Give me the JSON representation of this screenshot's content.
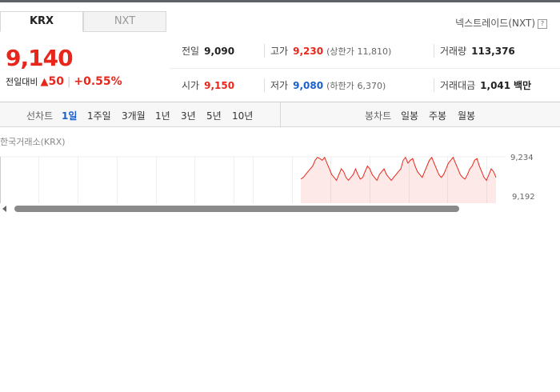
{
  "tabs": {
    "krx": "KRX",
    "nxt": "NXT"
  },
  "nxt_link": "넥스트레이드(NXT)",
  "help_glyph": "?",
  "price": "9,140",
  "change": {
    "label": "전일대비",
    "amount": "50",
    "percent": "+0.55%"
  },
  "stats": {
    "prev_close": {
      "label": "전일",
      "value": "9,090"
    },
    "high": {
      "label": "고가",
      "value": "9,230",
      "limit_label": "(상한가",
      "limit_value": "11,810)"
    },
    "volume": {
      "label": "거래량",
      "value": "113,376"
    },
    "open": {
      "label": "시가",
      "value": "9,150"
    },
    "low": {
      "label": "저가",
      "value": "9,080",
      "limit_label": "(하한가",
      "limit_value": "6,370)"
    },
    "amount": {
      "label": "거래대금",
      "value": "1,041",
      "unit": "백만"
    }
  },
  "line_chart_label": "선차트",
  "periods": [
    "1일",
    "1주일",
    "3개월",
    "1년",
    "3년",
    "5년",
    "10년"
  ],
  "active_period": "1일",
  "candle_chart_label": "봉차트",
  "candles": [
    "일봉",
    "주봉",
    "월봉"
  ],
  "chart_data": {
    "type": "line",
    "title": "한국거래소(KRX)",
    "y_ticks": [
      "9,234",
      "9,192"
    ],
    "ylim": [
      9150,
      9245
    ],
    "series": [
      {
        "values": [
          9192,
          9195,
          9200,
          9205,
          9210,
          9215,
          9225,
          9230,
          9228,
          9225,
          9230,
          9220,
          9210,
          9200,
          9195,
          9190,
          9200,
          9210,
          9205,
          9195,
          9190,
          9195,
          9200,
          9210,
          9200,
          9192,
          9195,
          9205,
          9215,
          9210,
          9200,
          9195,
          9190,
          9200,
          9205,
          9210,
          9200,
          9195,
          9190,
          9195,
          9200,
          9205,
          9210,
          9225,
          9230,
          9220,
          9225,
          9228,
          9215,
          9205,
          9200,
          9195,
          9205,
          9215,
          9225,
          9230,
          9220,
          9210,
          9200,
          9195,
          9200,
          9210,
          9220,
          9225,
          9230,
          9220,
          9210,
          9200,
          9195,
          9192,
          9200,
          9210,
          9215,
          9225,
          9228,
          9215,
          9205,
          9195,
          9190,
          9200,
          9210,
          9205,
          9195
        ]
      }
    ]
  }
}
